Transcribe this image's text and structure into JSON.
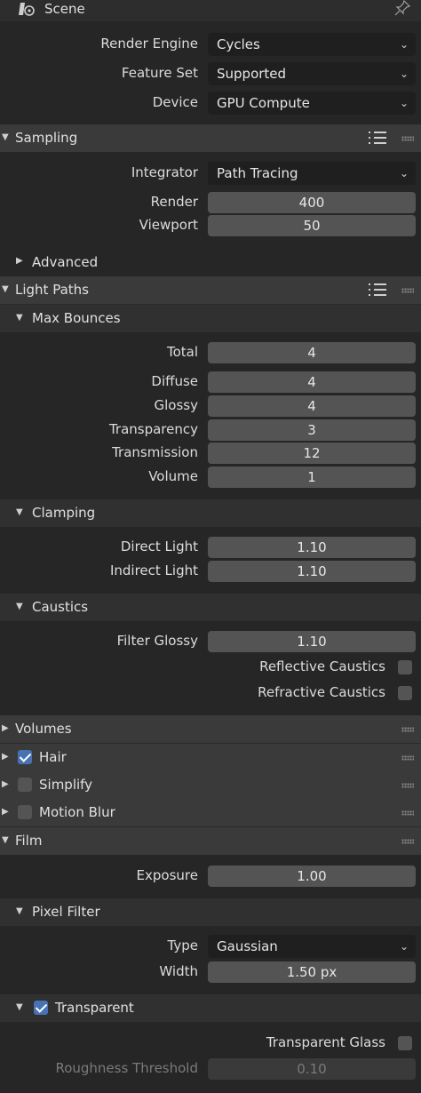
{
  "top": {
    "title": "Scene"
  },
  "render": {
    "engine_label": "Render Engine",
    "engine_value": "Cycles",
    "feature_label": "Feature Set",
    "feature_value": "Supported",
    "device_label": "Device",
    "device_value": "GPU Compute"
  },
  "sampling": {
    "title": "Sampling",
    "integrator_label": "Integrator",
    "integrator_value": "Path Tracing",
    "render_label": "Render",
    "render_value": "400",
    "viewport_label": "Viewport",
    "viewport_value": "50",
    "advanced_label": "Advanced"
  },
  "light_paths": {
    "title": "Light Paths",
    "max_bounces": {
      "title": "Max Bounces",
      "total_label": "Total",
      "total_value": "4",
      "diffuse_label": "Diffuse",
      "diffuse_value": "4",
      "glossy_label": "Glossy",
      "glossy_value": "4",
      "transparency_label": "Transparency",
      "transparency_value": "3",
      "transmission_label": "Transmission",
      "transmission_value": "12",
      "volume_label": "Volume",
      "volume_value": "1"
    },
    "clamping": {
      "title": "Clamping",
      "direct_label": "Direct Light",
      "direct_value": "1.10",
      "indirect_label": "Indirect Light",
      "indirect_value": "1.10"
    },
    "caustics": {
      "title": "Caustics",
      "filter_label": "Filter Glossy",
      "filter_value": "1.10",
      "reflective_label": "Reflective Caustics",
      "reflective_checked": false,
      "refractive_label": "Refractive Caustics",
      "refractive_checked": false
    }
  },
  "volumes": {
    "title": "Volumes"
  },
  "hair": {
    "title": "Hair",
    "checked": true
  },
  "simplify": {
    "title": "Simplify",
    "checked": false
  },
  "motion_blur": {
    "title": "Motion Blur",
    "checked": false
  },
  "film": {
    "title": "Film",
    "exposure_label": "Exposure",
    "exposure_value": "1.00",
    "pixel_filter": {
      "title": "Pixel Filter",
      "type_label": "Type",
      "type_value": "Gaussian",
      "width_label": "Width",
      "width_value": "1.50 px"
    },
    "transparent": {
      "title": "Transparent",
      "checked": true,
      "glass_label": "Transparent Glass",
      "glass_checked": false,
      "roughness_label": "Roughness Threshold",
      "roughness_value": "0.10"
    }
  },
  "colors": {
    "accent": "#4772b3",
    "header": "#3a3a3a",
    "panel": "#262626",
    "field": "#545454"
  }
}
